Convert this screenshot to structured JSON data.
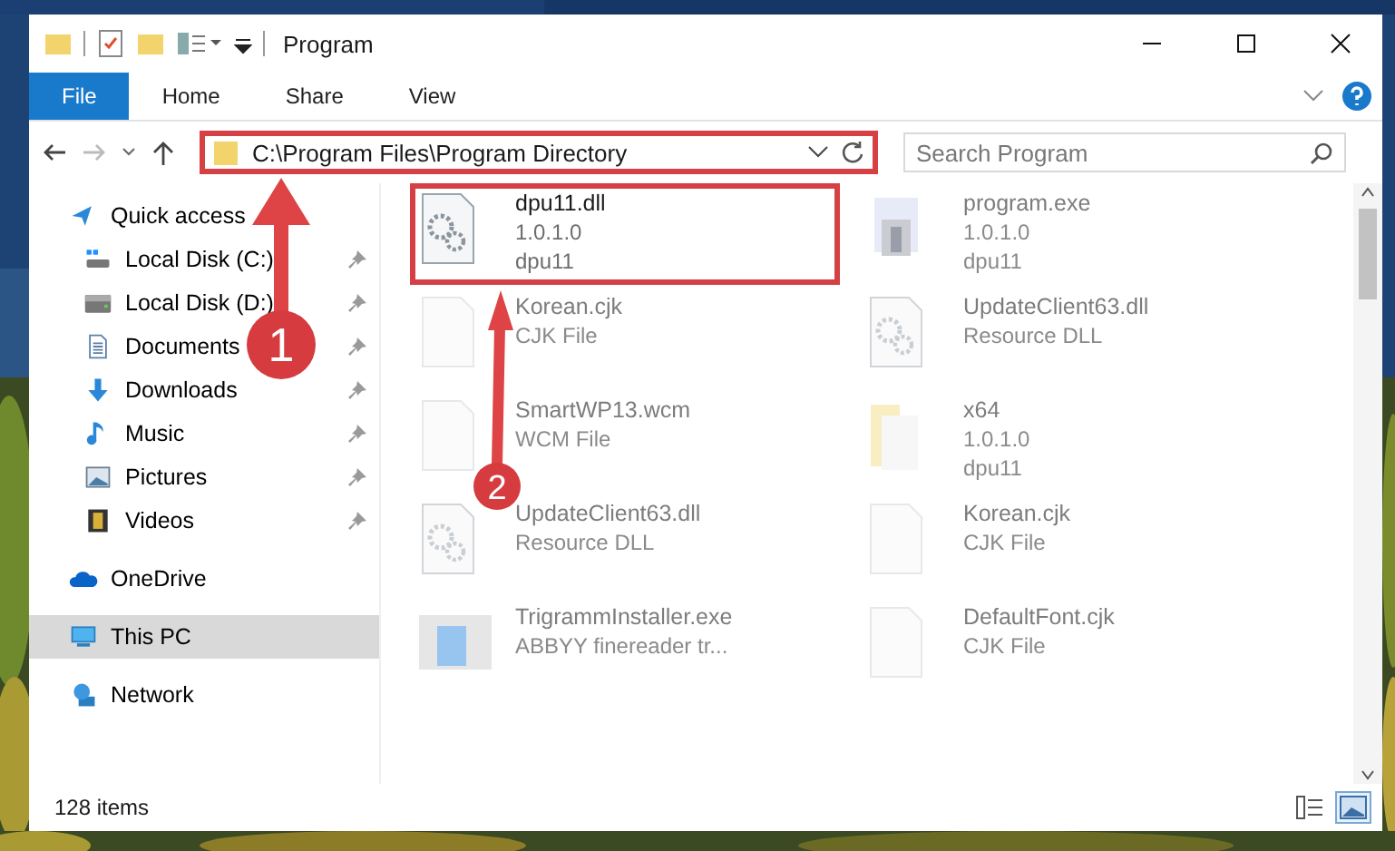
{
  "window": {
    "title": "Program"
  },
  "ribbon_tabs": [
    {
      "label": "File",
      "selected": true
    },
    {
      "label": "Home",
      "selected": false
    },
    {
      "label": "Share",
      "selected": false
    },
    {
      "label": "View",
      "selected": false
    }
  ],
  "address": {
    "path": "C:\\Program Files\\Program Directory",
    "highlighted": true
  },
  "search": {
    "placeholder": "Search Program"
  },
  "sidebar": {
    "items": [
      {
        "label": "Quick access",
        "kind": "quick",
        "selected": false,
        "children": [
          {
            "label": "Local Disk (C:)",
            "kind": "disk-c",
            "pinned": true
          },
          {
            "label": "Local Disk (D:)",
            "kind": "disk",
            "pinned": true
          },
          {
            "label": "Documents",
            "kind": "documents",
            "pinned": true
          },
          {
            "label": "Downloads",
            "kind": "downloads",
            "pinned": true
          },
          {
            "label": "Music",
            "kind": "music",
            "pinned": true
          },
          {
            "label": "Pictures",
            "kind": "pictures",
            "pinned": true
          },
          {
            "label": "Videos",
            "kind": "videos",
            "pinned": true
          }
        ]
      },
      {
        "label": "OneDrive",
        "kind": "onedrive",
        "selected": false
      },
      {
        "label": "This PC",
        "kind": "pc",
        "selected": true
      },
      {
        "label": "Network",
        "kind": "network",
        "selected": false
      }
    ]
  },
  "files": [
    {
      "name": "dpu11.dll",
      "lines": [
        "1.0.1.0",
        "dpu11"
      ],
      "kind": "dll",
      "highlighted": true,
      "dimmed": false
    },
    {
      "name": "program.exe",
      "lines": [
        "1.0.1.0",
        "dpu11"
      ],
      "kind": "exe",
      "highlighted": false,
      "dimmed": true
    },
    {
      "name": "Korean.cjk",
      "lines": [
        "CJK File"
      ],
      "kind": "blank",
      "highlighted": false,
      "dimmed": true
    },
    {
      "name": "UpdateClient63.dll",
      "lines": [
        "Resource DLL"
      ],
      "kind": "dll",
      "highlighted": false,
      "dimmed": true
    },
    {
      "name": "SmartWP13.wcm",
      "lines": [
        "WCM File"
      ],
      "kind": "blank",
      "highlighted": false,
      "dimmed": true
    },
    {
      "name": "x64",
      "lines": [
        "1.0.1.0",
        "dpu11"
      ],
      "kind": "folder",
      "highlighted": false,
      "dimmed": true
    },
    {
      "name": "UpdateClient63.dll",
      "lines": [
        "Resource DLL"
      ],
      "kind": "dll",
      "highlighted": false,
      "dimmed": true
    },
    {
      "name": "Korean.cjk",
      "lines": [
        "CJK File"
      ],
      "kind": "blank",
      "highlighted": false,
      "dimmed": true
    },
    {
      "name": "TrigrammInstaller.exe",
      "lines": [
        "ABBYY finereader tr..."
      ],
      "kind": "installer",
      "highlighted": false,
      "dimmed": true
    },
    {
      "name": "DefaultFont.cjk",
      "lines": [
        "CJK File"
      ],
      "kind": "blank",
      "highlighted": false,
      "dimmed": true
    }
  ],
  "status_bar": {
    "count": "128 items",
    "view_buttons": [
      {
        "kind": "details",
        "selected": false
      },
      {
        "kind": "large-icons",
        "selected": true
      }
    ]
  },
  "callouts": [
    {
      "number": "1"
    },
    {
      "number": "2"
    }
  ]
}
